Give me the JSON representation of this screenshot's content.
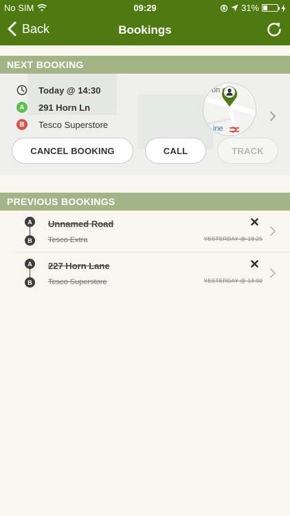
{
  "status": {
    "carrier": "No SIM",
    "time": "09:29",
    "battery": "31%",
    "battery_level": 0.31
  },
  "nav": {
    "back_label": "Back",
    "title": "Bookings"
  },
  "next_booking": {
    "header": "NEXT BOOKING",
    "time": "Today @ 14:30",
    "pickup": "291 Horn Ln",
    "dropoff": "Tesco Superstore",
    "pin_a": "A",
    "pin_b": "B",
    "map_text_top": "on e",
    "map_text_bottom": "ine",
    "buttons": {
      "cancel": "CANCEL BOOKING",
      "call": "CALL",
      "track": "TRACK"
    }
  },
  "previous": {
    "header": "PREVIOUS BOOKINGS",
    "items": [
      {
        "from": "Unnamed Road",
        "to": "Tesco Extra",
        "when": "YESTERDAY @ 18:25"
      },
      {
        "from": "227 Horn Lane",
        "to": "Tesco Superstore",
        "when": "YESTERDAY @ 13:00"
      }
    ]
  },
  "colors": {
    "brand": "#4f7a12",
    "section": "#a3b587",
    "pin_a": "#5cc14a",
    "pin_b": "#d9534f"
  }
}
